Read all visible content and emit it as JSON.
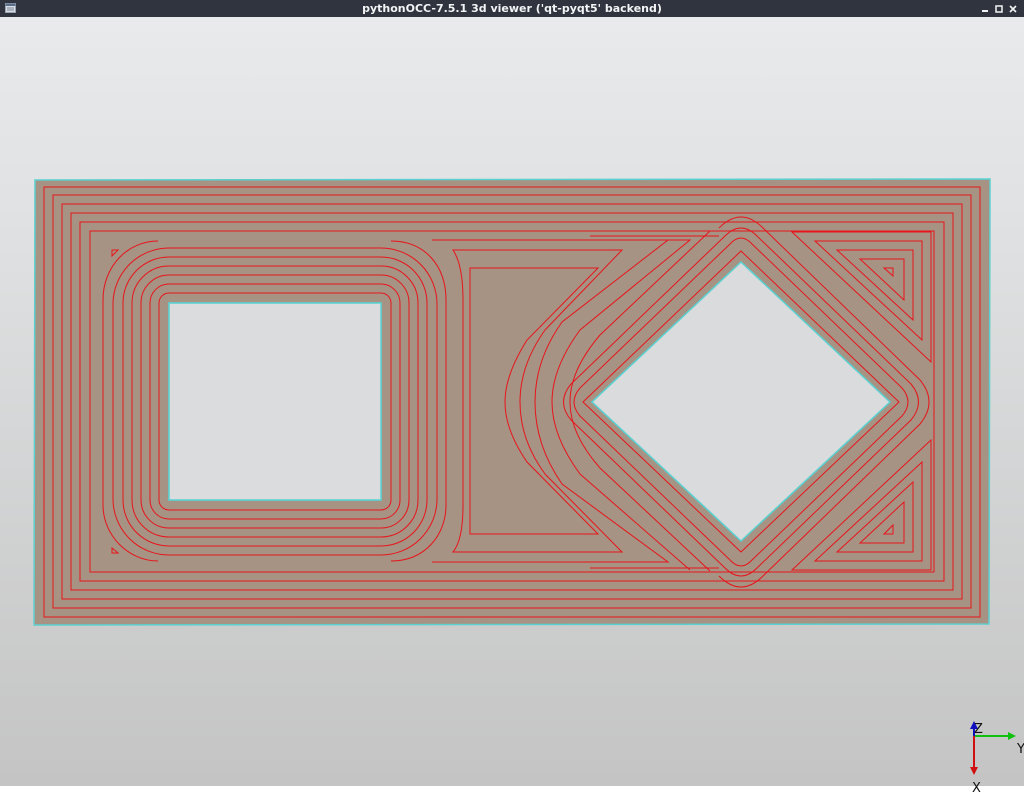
{
  "window": {
    "title": "pythonOCC-7.5.1 3d viewer ('qt-pyqt5' backend)",
    "controls": [
      "minimize",
      "maximize",
      "close"
    ]
  },
  "viewer": {
    "background": "gradient light gray",
    "face_color": "#a69383",
    "edge_color": "#5bd0d0",
    "toolpath_color": "#e8141b",
    "axes": {
      "z_label": "Z",
      "y_label": "Y",
      "x_label": "X"
    },
    "axis_colors": {
      "z": "#1010c0",
      "y": "#10c010",
      "x": "#d01010"
    }
  }
}
